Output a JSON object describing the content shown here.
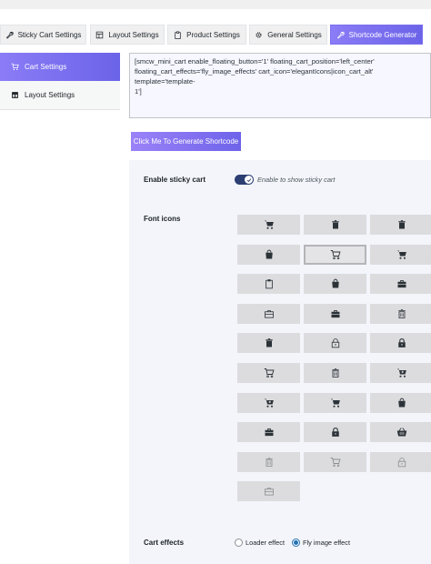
{
  "tabs": [
    {
      "label": "Sticky Cart Settings",
      "icon": "wrench-icon",
      "active": false
    },
    {
      "label": "Layout Settings",
      "icon": "layout-icon",
      "active": false
    },
    {
      "label": "Product Settings",
      "icon": "clipboard-icon",
      "active": false
    },
    {
      "label": "General Settings",
      "icon": "gear-icon",
      "active": false
    },
    {
      "label": "Shortcode Generator",
      "icon": "wrench-icon",
      "active": true
    }
  ],
  "sidebar": {
    "items": [
      {
        "label": "Cart Settings",
        "icon": "cart-icon",
        "active": true
      },
      {
        "label": "Layout Settings",
        "icon": "layout-icon",
        "active": false
      }
    ]
  },
  "shortcode": {
    "text": "[smcw_mini_cart enable_floating_button='1' floating_cart_position='left_center'\nfloating_cart_effects='fly_image_effects' cart_icon='elegantIcons|icon_cart_alt' template='template-\n1']"
  },
  "generate_button": {
    "label": "Click Me To Generate Shortcode"
  },
  "sticky": {
    "label": "Enable sticky cart",
    "toggle_text": "Enable to show sticky cart",
    "enabled": true
  },
  "font_icons": {
    "label": "Font icons",
    "selected_index": 4,
    "icons": [
      "cart-solid-icon",
      "trash-solid-icon",
      "trash-solid-icon",
      "shopping-bag-solid-icon",
      "cart-outline-icon",
      "cart-solid-icon",
      "clipboard-outline-icon",
      "shopping-bag-solid-icon",
      "briefcase-solid-icon",
      "briefcase-outline-icon",
      "briefcase-solid-icon",
      "trash-outline-icon",
      "trash-solid-icon",
      "lock-outline-icon",
      "lock-solid-icon",
      "cart-outline-icon",
      "trash-outline-icon",
      "cart-plus-solid-icon",
      "cart-plus-solid-icon",
      "cart-solid-icon",
      "shopping-bag-solid-icon",
      "briefcase-solid-icon",
      "lock-solid-icon",
      "basket-solid-icon",
      "trash-outline-icon",
      "cart-outline-icon",
      "lock-outline-icon",
      "briefcase-outline-icon"
    ]
  },
  "cart_effects": {
    "label": "Cart effects",
    "options": [
      {
        "label": "Loader effect",
        "checked": false
      },
      {
        "label": "Fly image effect",
        "checked": true
      }
    ]
  },
  "colors": {
    "accent_start": "#8b7cf6",
    "accent_end": "#6b63e8",
    "toggle": "#2c3e72",
    "radio": "#2271b1"
  }
}
